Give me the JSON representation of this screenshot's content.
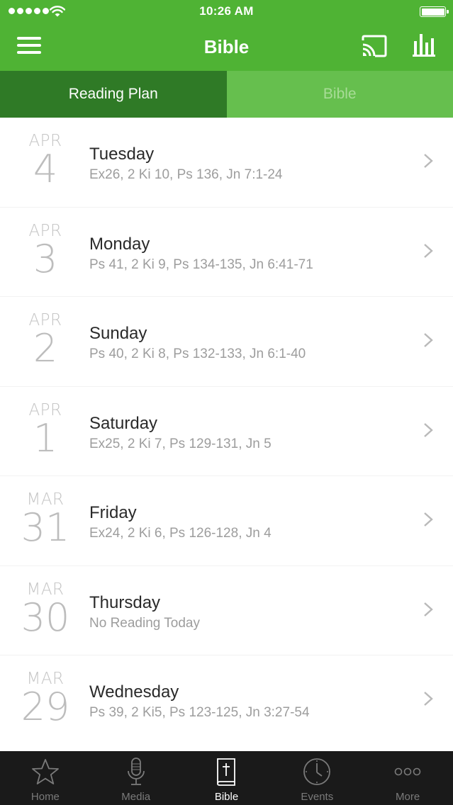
{
  "status_bar": {
    "time": "10:26 AM"
  },
  "header": {
    "title": "Bible"
  },
  "tabs": [
    {
      "label": "Reading Plan",
      "active": true
    },
    {
      "label": "Bible",
      "active": false
    }
  ],
  "plan": [
    {
      "month": "APR",
      "day": "4",
      "weekday": "Tuesday",
      "readings": "Ex26, 2 Ki 10, Ps 136, Jn 7:1-24"
    },
    {
      "month": "APR",
      "day": "3",
      "weekday": "Monday",
      "readings": "Ps 41, 2 Ki 9, Ps 134-135, Jn 6:41-71"
    },
    {
      "month": "APR",
      "day": "2",
      "weekday": "Sunday",
      "readings": "Ps 40, 2 Ki 8, Ps 132-133, Jn 6:1-40"
    },
    {
      "month": "APR",
      "day": "1",
      "weekday": "Saturday",
      "readings": "Ex25, 2 Ki 7, Ps 129-131, Jn 5"
    },
    {
      "month": "MAR",
      "day": "31",
      "weekday": "Friday",
      "readings": "Ex24, 2 Ki 6, Ps 126-128, Jn 4"
    },
    {
      "month": "MAR",
      "day": "30",
      "weekday": "Thursday",
      "readings": "No Reading Today"
    },
    {
      "month": "MAR",
      "day": "29",
      "weekday": "Wednesday",
      "readings": "Ps 39, 2 Ki5, Ps 123-125, Jn 3:27-54"
    }
  ],
  "tabbar": [
    {
      "label": "Home",
      "icon": "star-icon",
      "selected": false
    },
    {
      "label": "Media",
      "icon": "microphone-icon",
      "selected": false
    },
    {
      "label": "Bible",
      "icon": "bible-icon",
      "selected": true
    },
    {
      "label": "Events",
      "icon": "clock-icon",
      "selected": false
    },
    {
      "label": "More",
      "icon": "more-icon",
      "selected": false
    }
  ],
  "colors": {
    "brand": "#4fb334",
    "tab_active": "#2f7a26",
    "tab_inactive": "#66bf4e",
    "tabbar_bg": "#1a1a1a"
  }
}
